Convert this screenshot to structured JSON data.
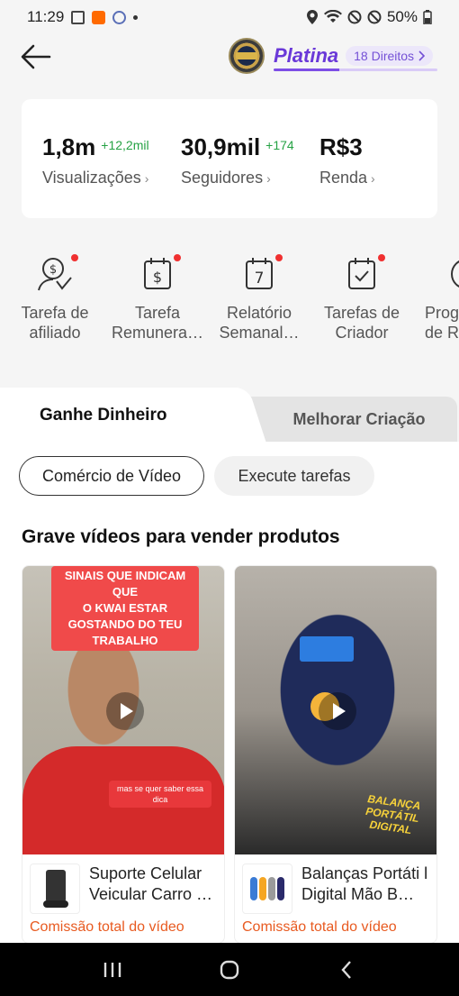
{
  "status_bar": {
    "time": "11:29",
    "battery": "50%"
  },
  "header": {
    "tier": "Platina",
    "rights_label": "18 Direitos"
  },
  "stats": [
    {
      "value": "1,8m",
      "delta": "+12,2mil",
      "label": "Visualizações"
    },
    {
      "value": "30,9mil",
      "delta": "+174",
      "label": "Seguidores"
    },
    {
      "value": "R$3",
      "delta": "",
      "label": "Renda"
    }
  ],
  "tasks": [
    {
      "label": "Tarefa de\nafiliado",
      "icon": "affiliate-money-icon",
      "dot": true
    },
    {
      "label": "Tarefa\nRemunera…",
      "icon": "paid-calendar-icon",
      "dot": true
    },
    {
      "label": "Relatório\nSemanal…",
      "icon": "calendar-7-icon",
      "dot": true
    },
    {
      "label": "Tarefas de\nCriador",
      "icon": "calendar-check-icon",
      "dot": true
    },
    {
      "label": "Prog\nde R",
      "icon": "partial-icon",
      "dot": false
    }
  ],
  "tabs": {
    "active": "Ganhe Dinheiro",
    "inactive": "Melhorar Criação"
  },
  "chips": {
    "active": "Comércio de Vídeo",
    "other": "Execute tarefas"
  },
  "section_title": "Grave vídeos para vender produtos",
  "videos": [
    {
      "caption_top": "SINAIS QUE INDICAM QUE\nO KWAI ESTAR\nGOSTANDO DO TEU\nTRABALHO",
      "caption_small": "mas se quer saber essa\ndica",
      "product_title": "Suporte Celular Veicular Carro …",
      "commission": "Comissão total do vídeo"
    },
    {
      "caption_top": "BALANÇA PORTÁTIL\nDIGITAL",
      "caption_small": "",
      "product_title": "Balanças Portáti l Digital Mão B…",
      "commission": "Comissão total do vídeo"
    }
  ],
  "colors": {
    "accent": "#6a39d8",
    "positive": "#25a244",
    "commission": "#e85a20"
  }
}
